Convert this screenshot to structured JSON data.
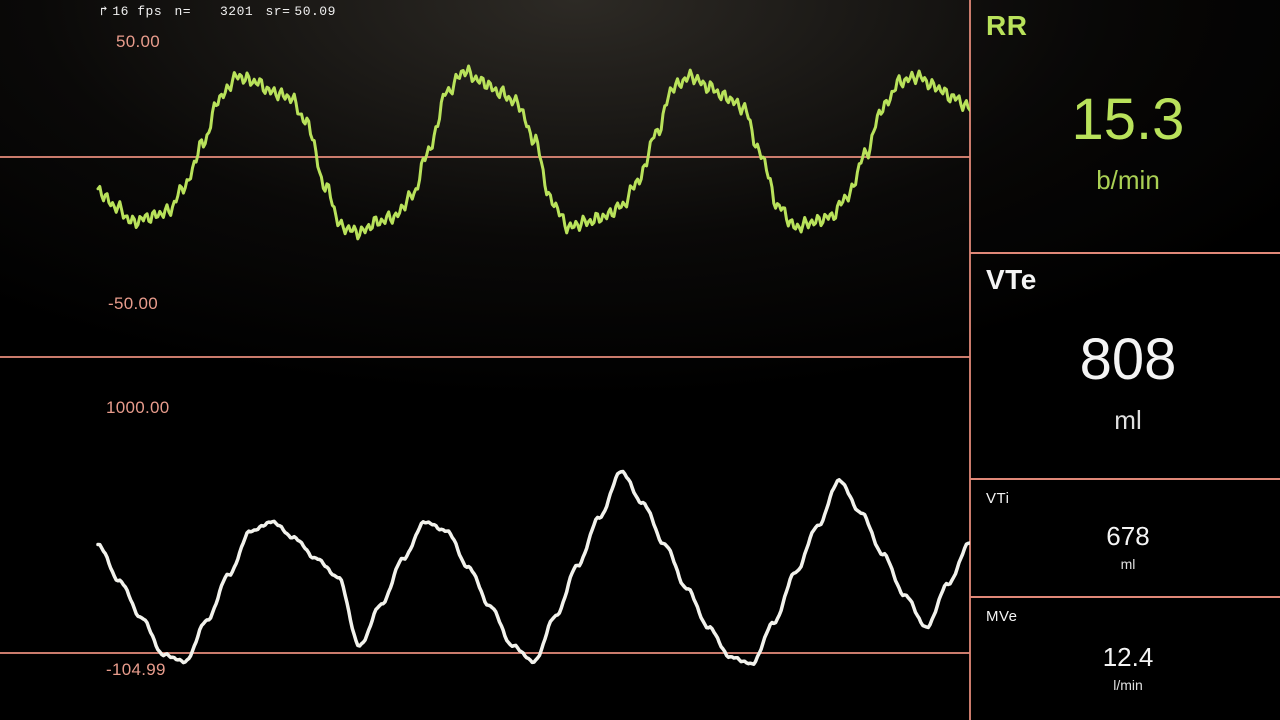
{
  "status": {
    "fps_label": "16 fps",
    "n_label": "n=",
    "n_value": "3201",
    "sr_label": "sr=",
    "sr_value": "50.09"
  },
  "chart_data": [
    {
      "type": "line",
      "name": "flow-waveform",
      "ylim": [
        -50,
        50
      ],
      "tick_top": "50.00",
      "tick_bottom": "-50.00",
      "zero_line": true,
      "color": "#b9e25b",
      "x": [
        0,
        0.02,
        0.04,
        0.06,
        0.08,
        0.1,
        0.12,
        0.14,
        0.16,
        0.18,
        0.2,
        0.22,
        0.24,
        0.26,
        0.28,
        0.3,
        0.32,
        0.34,
        0.36,
        0.38,
        0.4,
        0.42,
        0.44,
        0.46,
        0.48,
        0.5,
        0.52,
        0.54,
        0.56,
        0.58,
        0.6,
        0.62,
        0.64,
        0.66,
        0.68,
        0.7,
        0.72,
        0.74,
        0.76,
        0.78,
        0.8,
        0.82,
        0.84,
        0.86,
        0.88,
        0.9,
        0.92,
        0.94,
        0.96,
        0.98,
        1
      ],
      "values": [
        -8,
        -14,
        -20,
        -18,
        -16,
        -6,
        10,
        28,
        36,
        34,
        30,
        28,
        18,
        -6,
        -22,
        -24,
        -20,
        -18,
        -10,
        8,
        30,
        38,
        34,
        30,
        26,
        12,
        -12,
        -22,
        -20,
        -18,
        -14,
        -4,
        14,
        32,
        36,
        32,
        28,
        24,
        6,
        -14,
        -22,
        -20,
        -18,
        -10,
        6,
        24,
        34,
        36,
        32,
        28,
        24
      ]
    },
    {
      "type": "line",
      "name": "volume-waveform",
      "ylim": [
        -104.99,
        1000
      ],
      "tick_top": "1000.00",
      "tick_bottom": "-104.99",
      "color": "#f2f2ec",
      "x": [
        0,
        0.025,
        0.05,
        0.075,
        0.1,
        0.125,
        0.15,
        0.175,
        0.2,
        0.225,
        0.25,
        0.275,
        0.3,
        0.325,
        0.35,
        0.375,
        0.4,
        0.425,
        0.45,
        0.475,
        0.5,
        0.525,
        0.55,
        0.575,
        0.6,
        0.625,
        0.65,
        0.675,
        0.7,
        0.725,
        0.75,
        0.775,
        0.8,
        0.825,
        0.85,
        0.875,
        0.9,
        0.925,
        0.95,
        0.975,
        1
      ],
      "values": [
        420,
        260,
        100,
        -60,
        -90,
        90,
        290,
        480,
        520,
        450,
        360,
        280,
        -20,
        160,
        360,
        520,
        480,
        320,
        150,
        -20,
        -90,
        110,
        330,
        540,
        740,
        600,
        420,
        230,
        60,
        -70,
        -100,
        80,
        300,
        500,
        700,
        560,
        380,
        200,
        60,
        250,
        430
      ]
    }
  ],
  "tiles": {
    "RR": {
      "label": "RR",
      "value": "15.3",
      "unit": "b/min"
    },
    "VTe": {
      "label": "VTe",
      "value": "808",
      "unit": "ml"
    },
    "VTI": {
      "label": "VTi",
      "value": "678",
      "unit": "ml"
    },
    "MVe": {
      "label": "MVe",
      "value": "12.4",
      "unit": "l/min"
    }
  },
  "colors": {
    "grid_line": "#e08878",
    "flow_line": "#b9e25b",
    "volume_line": "#f2f2ec",
    "rr_text": "#b9e25b"
  }
}
